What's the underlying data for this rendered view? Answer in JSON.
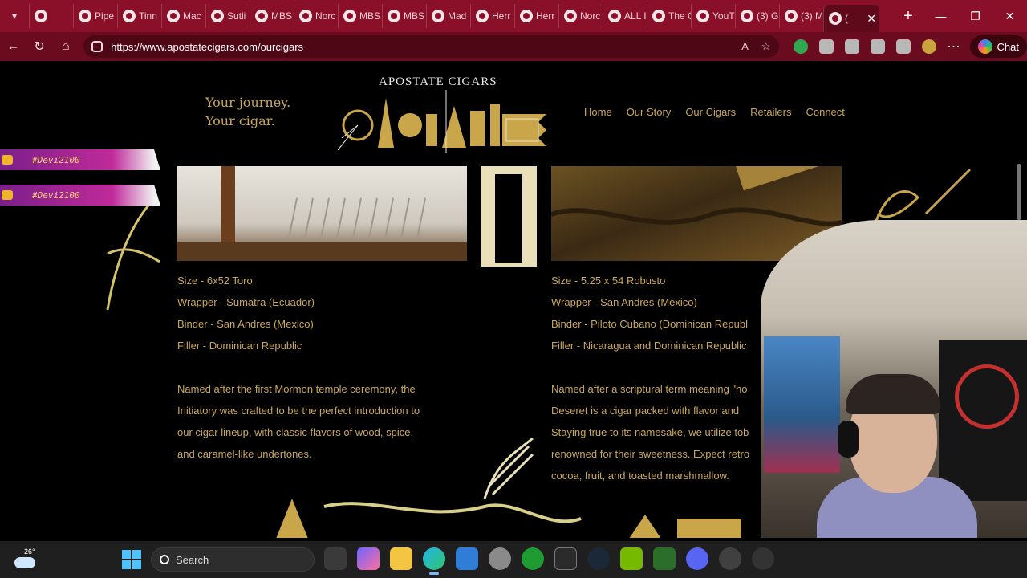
{
  "browser": {
    "tabs": [
      {
        "label": "",
        "favicon": "extension-icon"
      },
      {
        "label": "Pipe"
      },
      {
        "label": "Tinn"
      },
      {
        "label": "Mac"
      },
      {
        "label": "Sutli"
      },
      {
        "label": "MBS"
      },
      {
        "label": "Norc"
      },
      {
        "label": "MBS"
      },
      {
        "label": "MBS"
      },
      {
        "label": "Mad"
      },
      {
        "label": "Herr"
      },
      {
        "label": "Herr"
      },
      {
        "label": "Norc"
      },
      {
        "label": "ALL I"
      },
      {
        "label": "The C"
      },
      {
        "label": "YouT"
      },
      {
        "label": "(3) G"
      },
      {
        "label": "(3) M"
      },
      {
        "label": "("
      }
    ],
    "url": "https://www.apostatecigars.com/ourcigars",
    "chat_label": "Chat"
  },
  "site": {
    "tagline_line1": "Your journey.",
    "tagline_line2": "Your cigar.",
    "brand_title": "APOSTATE CIGARS",
    "nav": [
      "Home",
      "Our Story",
      "Our Cigars",
      "Retailers",
      "Connect"
    ]
  },
  "cigars": [
    {
      "size": "Size - 6x52 Toro",
      "wrapper": "Wrapper - Sumatra (Ecuador)",
      "binder": "Binder - San Andres (Mexico)",
      "filler": "Filler - Dominican Republic",
      "desc1": "Named after the first Mormon temple ceremony, the",
      "desc2": "Initiatory was crafted to be the perfect introduction to",
      "desc3": "our cigar lineup, with classic flavors of wood, spice,",
      "desc4": "and caramel-like undertones."
    },
    {
      "size": "Size - 5.25 x 54 Robusto",
      "wrapper": "Wrapper - San Andres (Mexico)",
      "binder": "Binder - Piloto Cubano (Dominican Republ",
      "filler": "Filler - Nicaragua and Dominican Republic",
      "desc1": "Named after a scriptural term meaning \"ho",
      "desc2": "Deseret is a cigar packed with flavor and",
      "desc3": "Staying true to its namesake, we utilize tob",
      "desc4": "renowned for their sweetness. Expect retro",
      "desc5": "cocoa, fruit, and toasted marshmallow."
    }
  ],
  "overlay": {
    "social_handles": [
      "#Devi2100",
      "#Devi2100"
    ]
  },
  "taskbar": {
    "temperature": "26°",
    "search_label": "Search"
  },
  "colors": {
    "browser_accent": "#8a0f28",
    "site_gold": "#c9a85a",
    "taskbar": "#1f1f1f"
  }
}
